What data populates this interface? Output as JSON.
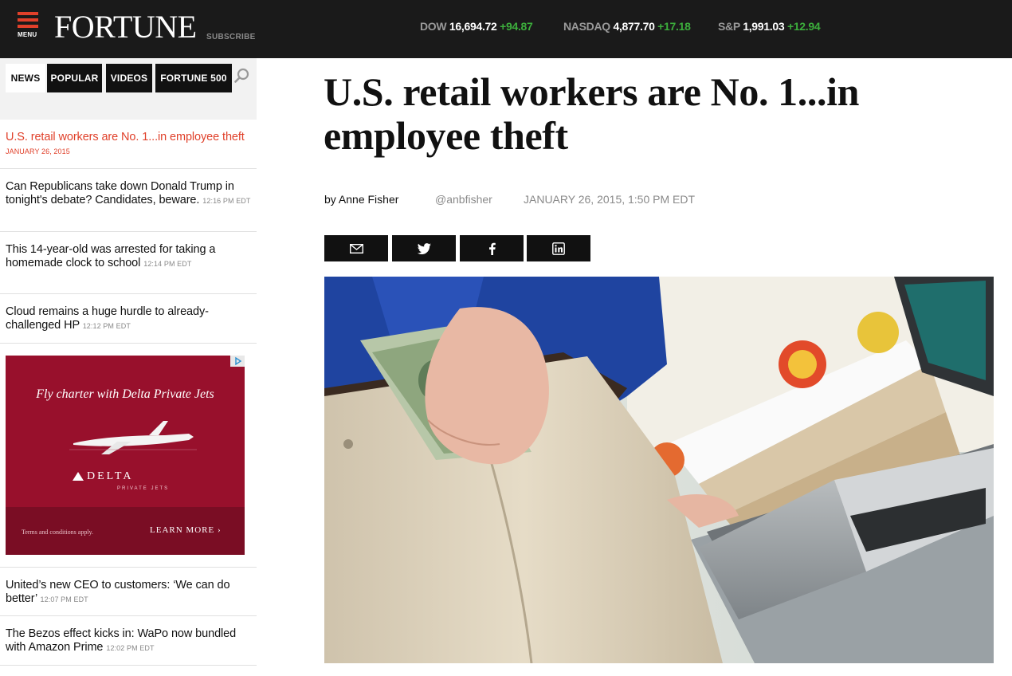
{
  "header": {
    "menu_label": "MENU",
    "logo": "FORTUNE",
    "subscribe": "SUBSCRIBE",
    "tickers": [
      {
        "name": "DOW",
        "value": "16,694.72",
        "change": "+94.87"
      },
      {
        "name": "NASDAQ",
        "value": "4,877.70",
        "change": "+17.18"
      },
      {
        "name": "S&P",
        "value": "1,991.03",
        "change": "+12.94"
      }
    ]
  },
  "sidebar": {
    "tabs": [
      "NEWS",
      "POPULAR",
      "VIDEOS",
      "FORTUNE 500"
    ],
    "active_tab": "NEWS",
    "stories": [
      {
        "title": "U.S. retail workers are No. 1...in employee theft",
        "time": "JANUARY 26, 2015"
      },
      {
        "title": "Can Republicans take down Donald Trump in tonight's debate? Candidates, beware.",
        "time": "12:16 PM EDT"
      },
      {
        "title": "This 14-year-old was arrested for taking a homemade clock to school",
        "time": "12:14 PM EDT"
      },
      {
        "title": "Cloud remains a huge hurdle to already-challenged HP",
        "time": "12:12 PM EDT"
      },
      {
        "title": "United’s new CEO to customers: ‘We can do better’",
        "time": "12:07 PM EDT"
      },
      {
        "title": "The Bezos effect kicks in: WaPo now bundled with Amazon Prime",
        "time": "12:02 PM EDT"
      }
    ],
    "ad": {
      "headline": "Fly charter with Delta Private Jets",
      "brand": "DELTA",
      "brand_sub": "PRIVATE JETS",
      "terms": "Terms and conditions apply.",
      "cta": "LEARN MORE ›"
    }
  },
  "article": {
    "title": "U.S. retail workers are No. 1...in employee theft",
    "author": "by Anne Fisher",
    "handle": "@anbfisher",
    "date": "JANUARY 26, 2015, 1:50 PM EDT",
    "share_icons": [
      "email-icon",
      "twitter-icon",
      "facebook-icon",
      "linkedin-icon"
    ]
  },
  "colors": {
    "accent": "#e0402a",
    "topbar": "#1a1a1a",
    "ticker_up": "#3cae3c",
    "ad_bg": "#98102c"
  }
}
